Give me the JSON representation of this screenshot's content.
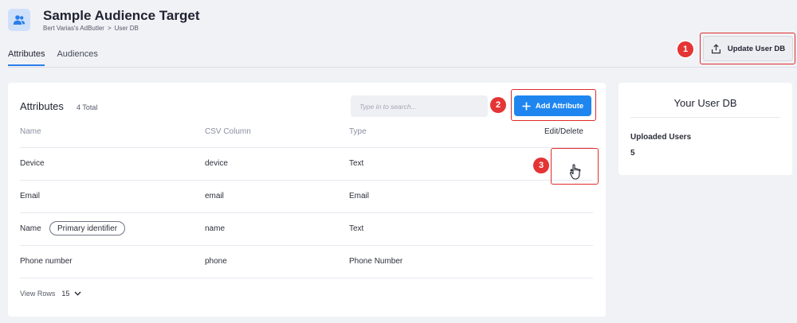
{
  "header": {
    "icon": "users-icon",
    "title": "Sample Audience Target",
    "breadcrumb": [
      "Bert Varias's AdButler",
      ">",
      "User DB"
    ]
  },
  "tabs": [
    {
      "label": "Attributes",
      "active": true
    },
    {
      "label": "Audiences",
      "active": false
    }
  ],
  "update_button": {
    "label": "Update User DB",
    "icon": "upload-icon"
  },
  "attributes_card": {
    "title": "Attributes",
    "count": "4 Total",
    "search_placeholder": "Type in to search...",
    "add_button": "Add Attribute",
    "columns": [
      "Name",
      "CSV Column",
      "Type",
      "Edit/Delete"
    ],
    "rows": [
      {
        "name": "Device",
        "csv": "device",
        "type": "Text",
        "badge": ""
      },
      {
        "name": "Email",
        "csv": "email",
        "type": "Email",
        "badge": ""
      },
      {
        "name": "Name",
        "csv": "name",
        "type": "Text",
        "badge": "Primary identifier"
      },
      {
        "name": "Phone number",
        "csv": "phone",
        "type": "Phone Number",
        "badge": ""
      }
    ],
    "view_rows_label": "View Rows",
    "view_rows_value": "15"
  },
  "side_card": {
    "title": "Your User DB",
    "label": "Uploaded Users",
    "value": "5"
  },
  "annotations": [
    "1",
    "2",
    "3"
  ],
  "colors": {
    "accent": "#1f86f0",
    "highlight": "#e02b2b",
    "tab_underline": "#2b7de9"
  }
}
